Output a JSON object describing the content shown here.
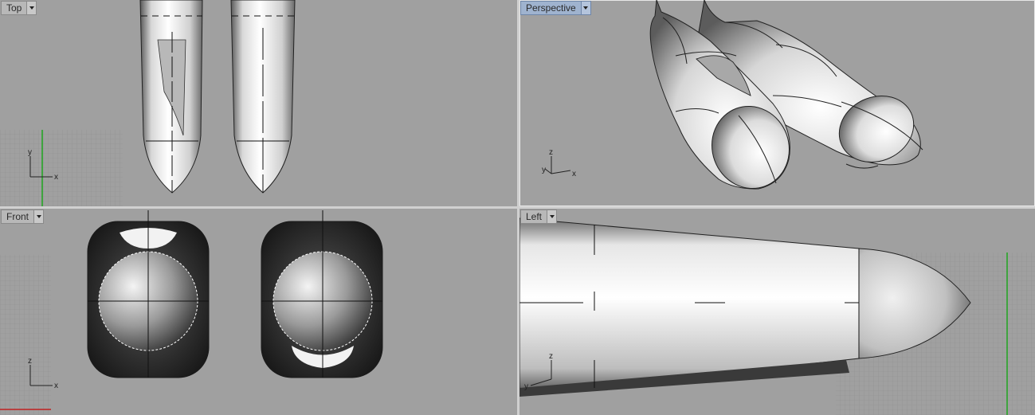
{
  "viewports": {
    "top": {
      "label": "Top",
      "axis_h": "x",
      "axis_v": "y"
    },
    "perspective": {
      "label": "Perspective",
      "axis_h": "x",
      "axis_v": "z",
      "axis_d": "y"
    },
    "front": {
      "label": "Front",
      "axis_h": "x",
      "axis_v": "z"
    },
    "left": {
      "label": "Left",
      "axis_v": "z",
      "axis_d": "y"
    }
  },
  "active_viewport": "perspective",
  "colors": {
    "viewport_bg": "#a0a0a0",
    "grid": "#8c8c8c",
    "active_tab": "#9fb3cf",
    "y_axis_line": "#1fa51f",
    "x_axis_line": "#c02020"
  },
  "icons": {
    "dropdown": "chevron-down-icon"
  }
}
